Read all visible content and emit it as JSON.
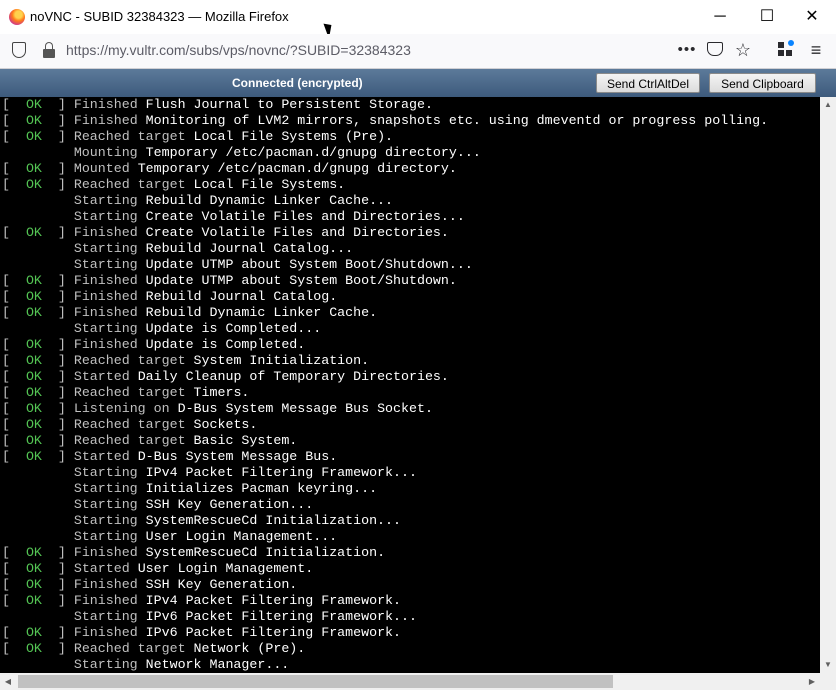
{
  "window": {
    "title": "noVNC - SUBID 32384323 — Mozilla Firefox",
    "minimize": "─",
    "maximize": "☐",
    "close": "✕"
  },
  "navbar": {
    "url": "https://my.vultr.com/subs/vps/novnc/?SUBID=32384323",
    "more_icon": "•••",
    "star_icon": "☆",
    "menu_icon": "≡"
  },
  "vnc": {
    "status": "Connected (encrypted)",
    "ctrl_alt_del": "Send CtrlAltDel",
    "clipboard": "Send Clipboard"
  },
  "terminal": {
    "lines": [
      {
        "ok": true,
        "verb": "Finished",
        "subject": "Flush Journal to Persistent Storage."
      },
      {
        "ok": true,
        "verb": "Finished",
        "subject": "Monitoring of LVM2 mirrors, snapshots etc. using dmeventd or progress polling."
      },
      {
        "ok": true,
        "verb": "Reached target",
        "subject": "Local File Systems (Pre)."
      },
      {
        "ok": false,
        "verb": "Mounting",
        "subject": "Temporary /etc/pacman.d/gnupg directory..."
      },
      {
        "ok": true,
        "verb": "Mounted",
        "subject": "Temporary /etc/pacman.d/gnupg directory."
      },
      {
        "ok": true,
        "verb": "Reached target",
        "subject": "Local File Systems."
      },
      {
        "ok": false,
        "verb": "Starting",
        "subject": "Rebuild Dynamic Linker Cache..."
      },
      {
        "ok": false,
        "verb": "Starting",
        "subject": "Create Volatile Files and Directories..."
      },
      {
        "ok": true,
        "verb": "Finished",
        "subject": "Create Volatile Files and Directories."
      },
      {
        "ok": false,
        "verb": "Starting",
        "subject": "Rebuild Journal Catalog..."
      },
      {
        "ok": false,
        "verb": "Starting",
        "subject": "Update UTMP about System Boot/Shutdown..."
      },
      {
        "ok": true,
        "verb": "Finished",
        "subject": "Update UTMP about System Boot/Shutdown."
      },
      {
        "ok": true,
        "verb": "Finished",
        "subject": "Rebuild Journal Catalog."
      },
      {
        "ok": true,
        "verb": "Finished",
        "subject": "Rebuild Dynamic Linker Cache."
      },
      {
        "ok": false,
        "verb": "Starting",
        "subject": "Update is Completed..."
      },
      {
        "ok": true,
        "verb": "Finished",
        "subject": "Update is Completed."
      },
      {
        "ok": true,
        "verb": "Reached target",
        "subject": "System Initialization."
      },
      {
        "ok": true,
        "verb": "Started",
        "subject": "Daily Cleanup of Temporary Directories."
      },
      {
        "ok": true,
        "verb": "Reached target",
        "subject": "Timers."
      },
      {
        "ok": true,
        "verb": "Listening on",
        "subject": "D-Bus System Message Bus Socket."
      },
      {
        "ok": true,
        "verb": "Reached target",
        "subject": "Sockets."
      },
      {
        "ok": true,
        "verb": "Reached target",
        "subject": "Basic System."
      },
      {
        "ok": true,
        "verb": "Started",
        "subject": "D-Bus System Message Bus."
      },
      {
        "ok": false,
        "verb": "Starting",
        "subject": "IPv4 Packet Filtering Framework..."
      },
      {
        "ok": false,
        "verb": "Starting",
        "subject": "Initializes Pacman keyring..."
      },
      {
        "ok": false,
        "verb": "Starting",
        "subject": "SSH Key Generation..."
      },
      {
        "ok": false,
        "verb": "Starting",
        "subject": "SystemRescueCd Initialization..."
      },
      {
        "ok": false,
        "verb": "Starting",
        "subject": "User Login Management..."
      },
      {
        "ok": true,
        "verb": "Finished",
        "subject": "SystemRescueCd Initialization."
      },
      {
        "ok": true,
        "verb": "Started",
        "subject": "User Login Management."
      },
      {
        "ok": true,
        "verb": "Finished",
        "subject": "SSH Key Generation."
      },
      {
        "ok": true,
        "verb": "Finished",
        "subject": "IPv4 Packet Filtering Framework."
      },
      {
        "ok": false,
        "verb": "Starting",
        "subject": "IPv6 Packet Filtering Framework..."
      },
      {
        "ok": true,
        "verb": "Finished",
        "subject": "IPv6 Packet Filtering Framework."
      },
      {
        "ok": true,
        "verb": "Reached target",
        "subject": "Network (Pre)."
      },
      {
        "ok": false,
        "verb": "Starting",
        "subject": "Network Manager..."
      }
    ]
  }
}
